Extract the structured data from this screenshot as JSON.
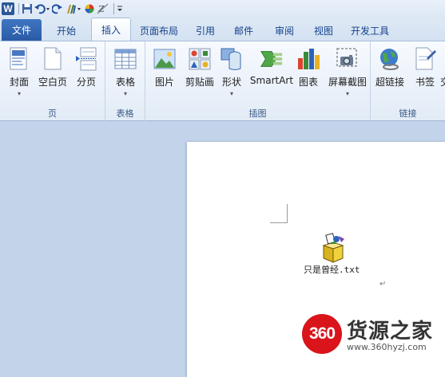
{
  "quick_access": {
    "app_icon": "word-icon",
    "app_letter": "W",
    "items": [
      "save-icon",
      "undo-icon",
      "redo-icon",
      "format-painter-icon",
      "color-icon",
      "clear-format-icon",
      "customize-icon"
    ]
  },
  "tabs": [
    {
      "label": "文件"
    },
    {
      "label": "开始"
    },
    {
      "label": "插入"
    },
    {
      "label": "页面布局"
    },
    {
      "label": "引用"
    },
    {
      "label": "邮件"
    },
    {
      "label": "审阅"
    },
    {
      "label": "视图"
    },
    {
      "label": "开发工具"
    }
  ],
  "active_tab": "插入",
  "ribbon": {
    "pages_group": {
      "label": "页",
      "buttons": [
        {
          "label": "封面",
          "icon": "cover-page-icon"
        },
        {
          "label": "空白页",
          "icon": "blank-page-icon"
        },
        {
          "label": "分页",
          "icon": "page-break-icon"
        }
      ]
    },
    "table_group": {
      "label": "表格",
      "buttons": [
        {
          "label": "表格",
          "icon": "table-icon"
        }
      ]
    },
    "illustrations_group": {
      "label": "插图",
      "buttons": [
        {
          "label": "图片",
          "icon": "picture-icon"
        },
        {
          "label": "剪贴画",
          "icon": "clip-art-icon"
        },
        {
          "label": "形状",
          "icon": "shapes-icon"
        },
        {
          "label": "SmartArt",
          "icon": "smartart-icon"
        },
        {
          "label": "图表",
          "icon": "chart-icon"
        },
        {
          "label": "屏幕截图",
          "icon": "screenshot-icon"
        }
      ]
    },
    "links_group": {
      "label": "链接",
      "buttons": [
        {
          "label": "超链接",
          "icon": "hyperlink-icon"
        },
        {
          "label": "书签",
          "icon": "bookmark-icon"
        },
        {
          "label": "交",
          "icon": "cross-reference-icon"
        }
      ]
    }
  },
  "document": {
    "attachment_name": "只是曾经.txt",
    "paragraph_mark": "↵"
  },
  "watermark": {
    "logo_text": "360",
    "title": "货源之家",
    "url": "www.360hyzj.com"
  },
  "colors": {
    "file_tab": "#2a5ba6",
    "ribbon_bg": "#e2ebf6",
    "workspace": "#c3d4ea",
    "watermark_red": "#d9141b"
  }
}
